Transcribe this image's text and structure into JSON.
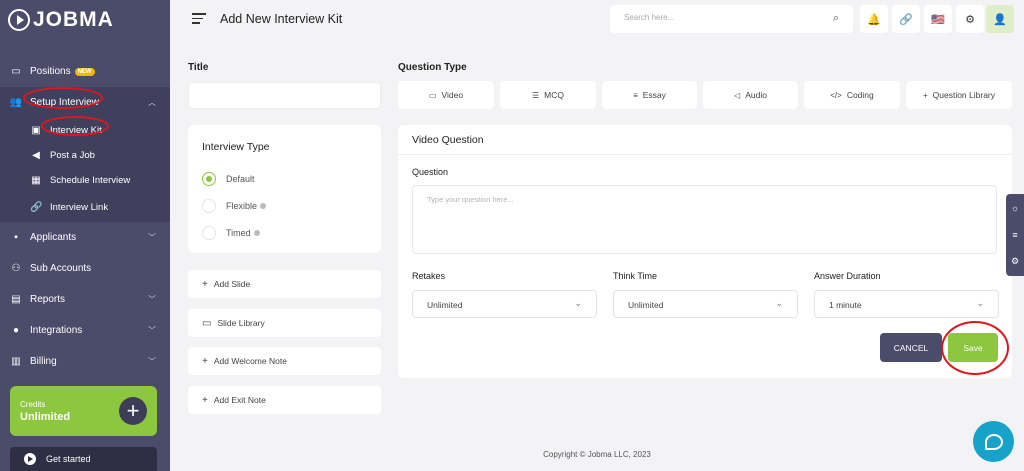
{
  "app": {
    "logo_text": "JOBMA"
  },
  "sidebar": {
    "items": [
      {
        "label": "Positions",
        "badge": "NEW",
        "icon": "briefcase-icon"
      },
      {
        "label": "Setup Interview",
        "icon": "users-icon"
      },
      {
        "label": "Applicants",
        "icon": "person-badge-icon"
      },
      {
        "label": "Sub Accounts",
        "icon": "user-plus-icon"
      },
      {
        "label": "Reports",
        "icon": "report-icon"
      },
      {
        "label": "Integrations",
        "icon": "integrations-icon"
      },
      {
        "label": "Billing",
        "icon": "billing-icon"
      }
    ],
    "subitems": [
      {
        "label": "Interview Kit",
        "icon": "kit-icon"
      },
      {
        "label": "Post a Job",
        "icon": "megaphone-icon"
      },
      {
        "label": "Schedule Interview",
        "icon": "calendar-icon"
      },
      {
        "label": "Interview Link",
        "icon": "link-icon"
      }
    ],
    "credits": {
      "label": "Credits",
      "value": "Unlimited"
    },
    "get_started": "Get started"
  },
  "header": {
    "title": "Add New Interview Kit",
    "search_placeholder": "Search here..."
  },
  "form": {
    "title_label": "Title",
    "interview_type": {
      "title": "Interview Type",
      "options": [
        "Default",
        "Flexible",
        "Timed"
      ],
      "selected": "Default"
    },
    "side_actions": [
      "Add Slide",
      "Slide Library",
      "Add Welcome Note",
      "Add Exit Note"
    ],
    "question_type_label": "Question Type",
    "question_types": [
      "Video",
      "MCQ",
      "Essay",
      "Audio",
      "Coding",
      "Question Library"
    ],
    "video_question": {
      "title": "Video Question",
      "question_label": "Question",
      "question_placeholder": "Type your question here...",
      "retakes_label": "Retakes",
      "retakes_value": "Unlimited",
      "think_time_label": "Think Time",
      "think_time_value": "Unlimited",
      "answer_duration_label": "Answer Duration",
      "answer_duration_value": "1 minute",
      "cancel_label": "CANCEL",
      "save_label": "Save"
    }
  },
  "footer": {
    "copyright": "Copyright © Jobma LLC, 2023"
  },
  "colors": {
    "accent": "#8dc63f",
    "sidebar": "#4b4b6a",
    "annotation": "#e2151c",
    "chat": "#16a3c9"
  }
}
